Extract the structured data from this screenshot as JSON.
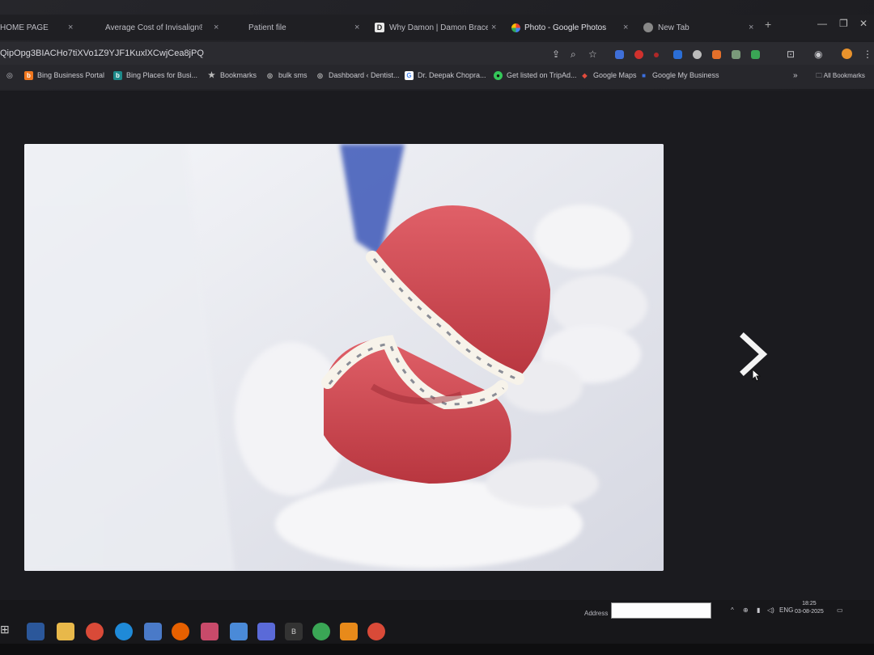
{
  "tabs": [
    {
      "label": "HOME PAGE",
      "close": "×"
    },
    {
      "label": "Average Cost of Invisalign® ...",
      "close": "×"
    },
    {
      "label": "Patient file",
      "close": "×"
    },
    {
      "label": "Why Damon | Damon Braces",
      "close": "×",
      "icon": "D"
    },
    {
      "label": "Photo - Google Photos",
      "close": "×",
      "active": true
    },
    {
      "label": "New Tab",
      "close": "×"
    }
  ],
  "new_tab": "+",
  "url": "QipOpg3BIACHo7tiXVo1Z9YJF1KuxlXCwjCea8jPQ",
  "bookmarks": [
    {
      "label": "Bing Business Portal",
      "icon": "b",
      "color": "#f0771e"
    },
    {
      "label": "Bing Places for Busi...",
      "icon": "b",
      "color": "#1d8a8a"
    },
    {
      "label": "Bookmarks",
      "icon": "★",
      "color": "#555"
    },
    {
      "label": "bulk sms",
      "icon": "◎",
      "color": "#666"
    },
    {
      "label": "Dashboard ‹ Dentist...",
      "icon": "◎",
      "color": "#666"
    },
    {
      "label": "Dr. Deepak Chopra...",
      "icon": "G",
      "color": "#ffffff"
    },
    {
      "label": "Get listed on TripAd...",
      "icon": "●",
      "color": "#34c759"
    },
    {
      "label": "Google Maps",
      "icon": "◆",
      "color": "#e04b3c"
    },
    {
      "label": "Google My Business",
      "icon": "■",
      "color": "#3b6fe0"
    }
  ],
  "all_bookmarks": "All Bookmarks",
  "taskbar": {
    "address_label": "Address",
    "language": "ENG",
    "time": "18:25",
    "date": "03-08-2025"
  },
  "colors": {
    "gum": "#d94b55",
    "glove": "#f4f4f6",
    "coat_blue": "#3c58b8"
  }
}
